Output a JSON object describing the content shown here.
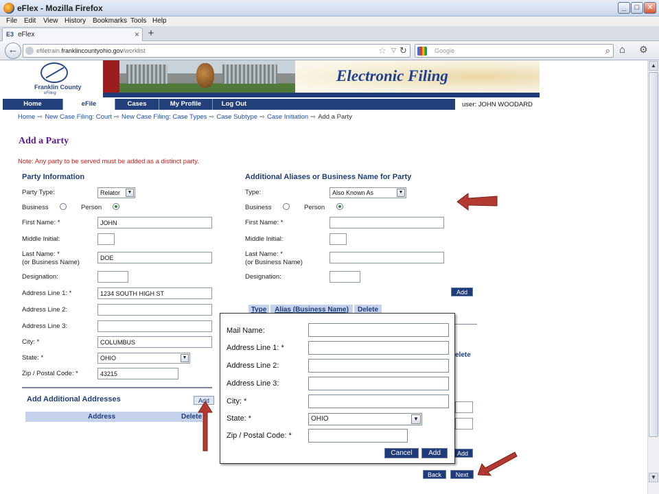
{
  "window": {
    "title": "eFlex - Mozilla Firefox",
    "controls": {
      "minimize": "_",
      "maximize": "□",
      "close": "✕"
    }
  },
  "menu": [
    "File",
    "Edit",
    "View",
    "History",
    "Bookmarks",
    "Tools",
    "Help"
  ],
  "tab": {
    "label": "eFlex",
    "icon": "E3",
    "close": "×",
    "new_tab": "+"
  },
  "navbar": {
    "url_prefix": "efiletrain.",
    "url_domain": "franklincountyohio.gov",
    "url_path": "/worklist",
    "search_placeholder": "Google"
  },
  "banner": {
    "logo_text": "Franklin County",
    "logo_sub": "eFiling",
    "site_title": "Electronic Filing"
  },
  "site_nav": [
    "Home",
    "eFile",
    "Cases",
    "My Profile",
    "Log Out"
  ],
  "user": "user: JOHN WOODARD",
  "breadcrumb": [
    "Home",
    "New Case Filing: Court",
    "New Case Filing: Case Types",
    "Case Subtype",
    "Case Initiation",
    "Add a Party"
  ],
  "breadcrumb_sep": "⇨",
  "page_title": "Add a Party",
  "note": "Note:  Any party to be served must be added as a distinct party.",
  "party": {
    "heading": "Party Information",
    "party_type_label": "Party Type:",
    "party_type_value": "Relator",
    "business_label": "Business",
    "person_label": "Person",
    "first_name_label": "First Name: *",
    "first_name": "JOHN",
    "middle_label": "Middle Initial:",
    "middle": "",
    "last_label_1": "Last Name: *",
    "last_label_2": "(or Business Name)",
    "last_name": "DOE",
    "designation_label": "Designation:",
    "designation": "",
    "addr1_label": "Address Line 1: *",
    "addr1": "1234 SOUTH HIGH ST",
    "addr2_label": "Address Line 2:",
    "addr2": "",
    "addr3_label": "Address Line 3:",
    "addr3": "",
    "city_label": "City: *",
    "city": "COLUMBUS",
    "state_label": "State: *",
    "state": "OHIO",
    "zip_label": "Zip / Postal Code: *",
    "zip": "43215"
  },
  "additional_addresses": {
    "heading": "Add Additional Addresses",
    "add": "Add",
    "col_address": "Address",
    "col_delete": "Delete"
  },
  "alias": {
    "heading": "Additional Aliases or Business Name for Party",
    "type_label": "Type:",
    "type_value": "Also Known As",
    "business_label": "Business",
    "person_label": "Person",
    "first_name_label": "First Name: *",
    "middle_label": "Middle Initial:",
    "last_label_1": "Last Name: *",
    "last_label_2": "(or Business Name)",
    "designation_label": "Designation:",
    "add": "Add",
    "col_type": "Type",
    "col_alias": "Alias (Business Name)",
    "col_delete": "Delete",
    "col_delete_2": "elete",
    "add_2": "Add"
  },
  "popup": {
    "mail_name_label": "Mail Name:",
    "addr1_label": "Address Line 1: *",
    "addr2_label": "Address Line 2:",
    "addr3_label": "Address Line 3:",
    "city_label": "City: *",
    "state_label": "State: *",
    "state": "OHIO",
    "zip_label": "Zip / Postal Code: *",
    "cancel": "Cancel",
    "add": "Add"
  },
  "footer_buttons": {
    "back": "Back",
    "next": "Next"
  },
  "colors": {
    "nav": "#23407a",
    "arrow": "#b23a33",
    "note": "#cc1b1b",
    "title": "#5b1a8a"
  }
}
